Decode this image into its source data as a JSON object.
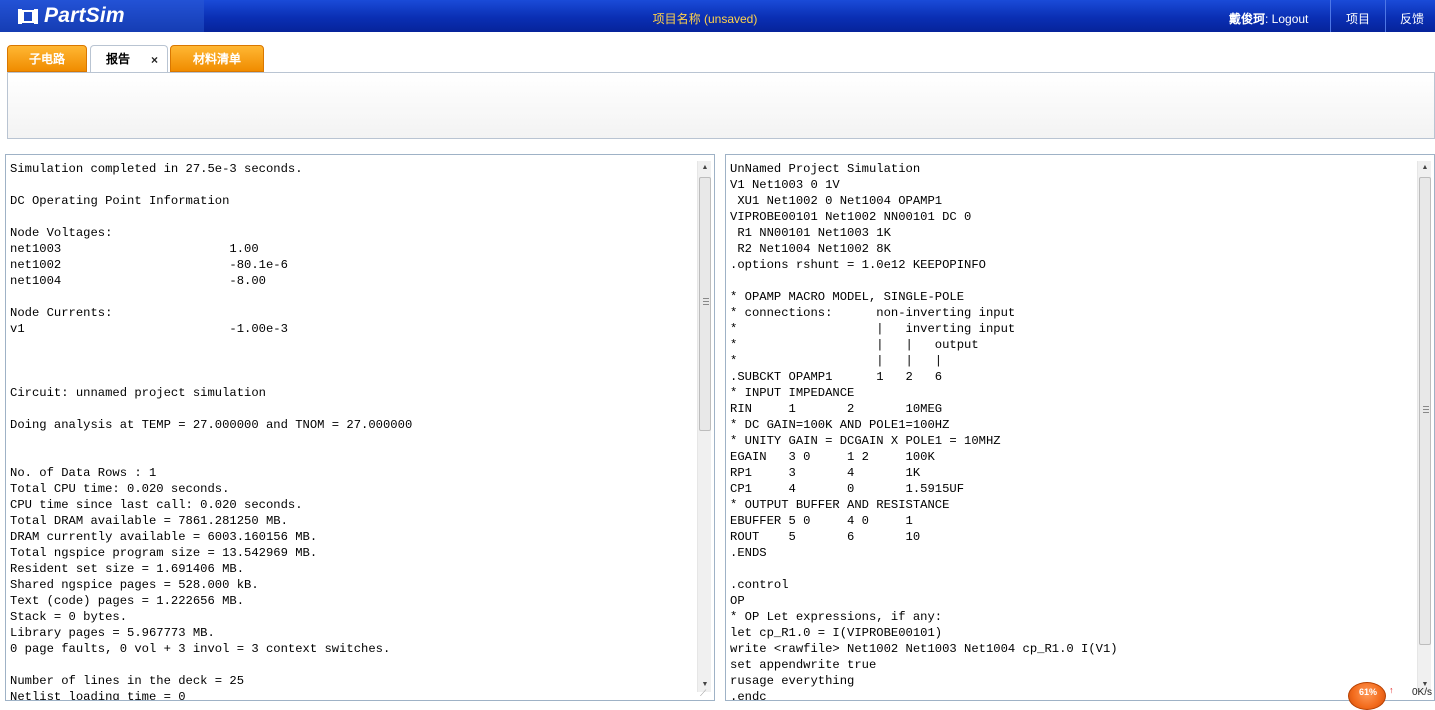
{
  "header": {
    "logo_text": "PartSim",
    "project_title": "项目名称 (unsaved)",
    "user_name": "戴俊珂",
    "logout_label": ": Logout",
    "nav_items": [
      "项目",
      "反馈"
    ]
  },
  "tabs": [
    {
      "label": "子电路",
      "active": false
    },
    {
      "label": "报告",
      "active": true,
      "close_glyph": "×"
    },
    {
      "label": "材料清单",
      "active": false
    }
  ],
  "left_pane": {
    "text": "Simulation completed in 27.5e-3 seconds.\n\nDC Operating Point Information\n\nNode Voltages:\nnet1003                       1.00\nnet1002                       -80.1e-6\nnet1004                       -8.00\n\nNode Currents:\nv1                            -1.00e-3\n\n\n\nCircuit: unnamed project simulation\n\nDoing analysis at TEMP = 27.000000 and TNOM = 27.000000\n\n\nNo. of Data Rows : 1\nTotal CPU time: 0.020 seconds.\nCPU time since last call: 0.020 seconds.\nTotal DRAM available = 7861.281250 MB.\nDRAM currently available = 6003.160156 MB.\nTotal ngspice program size = 13.542969 MB.\nResident set size = 1.691406 MB.\nShared ngspice pages = 528.000 kB.\nText (code) pages = 1.222656 MB.\nStack = 0 bytes.\nLibrary pages = 5.967773 MB.\n0 page faults, 0 vol + 3 invol = 3 context switches.\n\nNumber of lines in the deck = 25\nNetlist loading time = 0"
  },
  "right_pane": {
    "text": "UnNamed Project Simulation\nV1 Net1003 0 1V\n XU1 Net1002 0 Net1004 OPAMP1\nVIPROBE00101 Net1002 NN00101 DC 0\n R1 NN00101 Net1003 1K\n R2 Net1004 Net1002 8K\n.options rshunt = 1.0e12 KEEPOPINFO\n\n* OPAMP MACRO MODEL, SINGLE-POLE\n* connections:      non-inverting input\n*                   |   inverting input\n*                   |   |   output\n*                   |   |   |\n.SUBCKT OPAMP1      1   2   6\n* INPUT IMPEDANCE\nRIN     1       2       10MEG\n* DC GAIN=100K AND POLE1=100HZ\n* UNITY GAIN = DCGAIN X POLE1 = 10MHZ\nEGAIN   3 0     1 2     100K\nRP1     3       4       1K\nCP1     4       0       1.5915UF\n* OUTPUT BUFFER AND RESISTANCE\nEBUFFER 5 0     4 0     1\nROUT    5       6       10\n.ENDS\n\n.control\nOP\n* OP Let expressions, if any:\nlet cp_R1.0 = I(VIPROBE00101)\nwrite <rawfile> Net1002 Net1003 Net1004 cp_R1.0 I(V1)\nset appendwrite true\nrusage everything\n.endc"
  },
  "speed_widget": {
    "percent": "61%",
    "arrow": "↑",
    "rate": "0K/s"
  },
  "colors": {
    "header_blue": "#0a2fb4",
    "title_yellow": "#ffd24a",
    "tab_orange": "#f08c00"
  }
}
